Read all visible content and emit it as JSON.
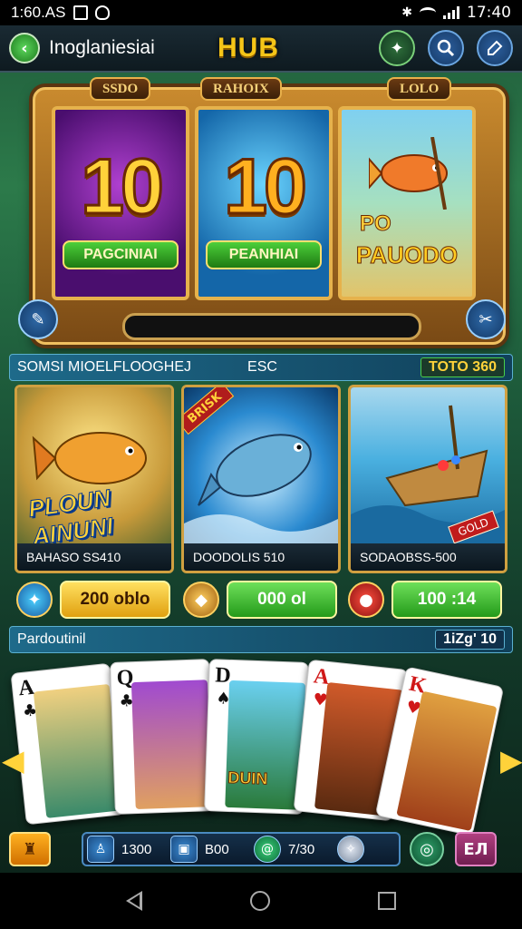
{
  "status_bar": {
    "time_left": "1:60.AS",
    "time_right": "17:40"
  },
  "top_bar": {
    "app_name": "Inoglaniesiai",
    "logo": "HUB"
  },
  "slot_machine": {
    "labels": [
      "SSDO",
      "RAHOIX",
      "LOLO"
    ],
    "reels": [
      {
        "number": "10",
        "banner": "PAGCINIAI"
      },
      {
        "number": "10",
        "banner": "PEANHIAI"
      },
      {
        "small_word": "PO",
        "banner": "PAUODO"
      }
    ]
  },
  "section1": {
    "title": "SOMSI MIOELFLOOGHEJ",
    "middle": "ESC",
    "tag": "TOTO 360"
  },
  "games": [
    {
      "art_text": "PLOUN AINUNI",
      "caption": "BAHASO SS410"
    },
    {
      "ribbon": "BRISK",
      "caption": "DOODOLIS 510"
    },
    {
      "ribbon": "GOLD",
      "caption": "SODAOBSS-500"
    }
  ],
  "buy_buttons": [
    {
      "label": "200 oblo",
      "style": "yellow"
    },
    {
      "label": "000 ol",
      "style": "green"
    },
    {
      "label": "100 :14",
      "style": "green"
    }
  ],
  "section2": {
    "title": "Pardoutinil",
    "tag": "1iZg' 10"
  },
  "cards": [
    {
      "rank": "A",
      "suit": "♣",
      "color": "black"
    },
    {
      "rank": "Q",
      "suit": "♣",
      "color": "black"
    },
    {
      "rank": "D",
      "suit": "♠",
      "color": "black"
    },
    {
      "rank": "A",
      "suit": "♥",
      "color": "red"
    },
    {
      "rank": "K",
      "suit": "♥",
      "color": "red"
    }
  ],
  "card3_text": "DUIN",
  "bottom_stats": [
    {
      "value": "1300"
    },
    {
      "value": "B00"
    },
    {
      "value": "7/30"
    }
  ],
  "bottom_right_label": "ЕЛ",
  "icons": {
    "back": "back-arrow-icon",
    "gift": "gift-icon",
    "search": "search-icon",
    "edit": "edit-icon",
    "trophy": "trophy-icon"
  }
}
